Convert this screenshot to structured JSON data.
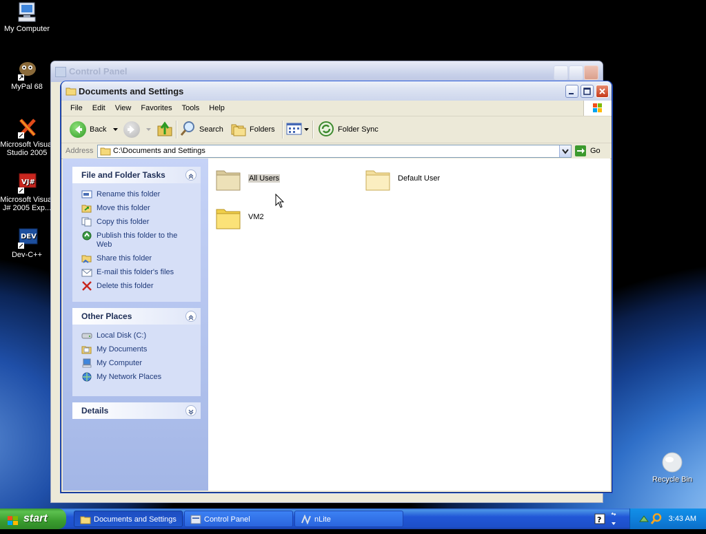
{
  "desktop": {
    "icons": [
      {
        "label": "My Computer",
        "icon": "my-computer-icon"
      },
      {
        "label": "MyPal 68",
        "icon": "mypal-icon"
      },
      {
        "label": "Microsoft Visual Studio 2005",
        "icon": "visual-studio-icon"
      },
      {
        "label": "Microsoft Visual J# 2005 Exp...",
        "icon": "vjsharp-icon"
      },
      {
        "label": "Dev-C++",
        "icon": "dev-cpp-icon"
      },
      {
        "label": "Recycle Bin",
        "icon": "recycle-bin-icon"
      }
    ]
  },
  "back_window": {
    "title": "Control Panel"
  },
  "window": {
    "title": "Documents and Settings",
    "menu": [
      "File",
      "Edit",
      "View",
      "Favorites",
      "Tools",
      "Help"
    ],
    "toolbar": {
      "back": "Back",
      "search": "Search",
      "folders": "Folders",
      "folder_sync": "Folder Sync"
    },
    "address": {
      "label": "Address",
      "value": "C:\\Documents and Settings",
      "go": "Go"
    },
    "tasks": {
      "file_folder": {
        "title": "File and Folder Tasks",
        "items": [
          "Rename this folder",
          "Move this folder",
          "Copy this folder",
          "Publish this folder to the Web",
          "Share this folder",
          "E-mail this folder's files",
          "Delete this folder"
        ]
      },
      "other_places": {
        "title": "Other Places",
        "items": [
          "Local Disk (C:)",
          "My Documents",
          "My Computer",
          "My Network Places"
        ]
      },
      "details": {
        "title": "Details"
      }
    },
    "files": [
      {
        "name": "All Users",
        "selected": true
      },
      {
        "name": "Default User",
        "selected": false
      },
      {
        "name": "VM2",
        "selected": false
      }
    ]
  },
  "taskbar": {
    "start": "start",
    "buttons": [
      "Documents and Settings",
      "Control Panel",
      "nLite"
    ],
    "clock": "3:43 AM"
  },
  "colors": {
    "taskbar_blue": "#245edb",
    "start_green": "#3c9b35",
    "task_pane_blue": "#d6dff7",
    "link_blue": "#1f3a7a"
  }
}
